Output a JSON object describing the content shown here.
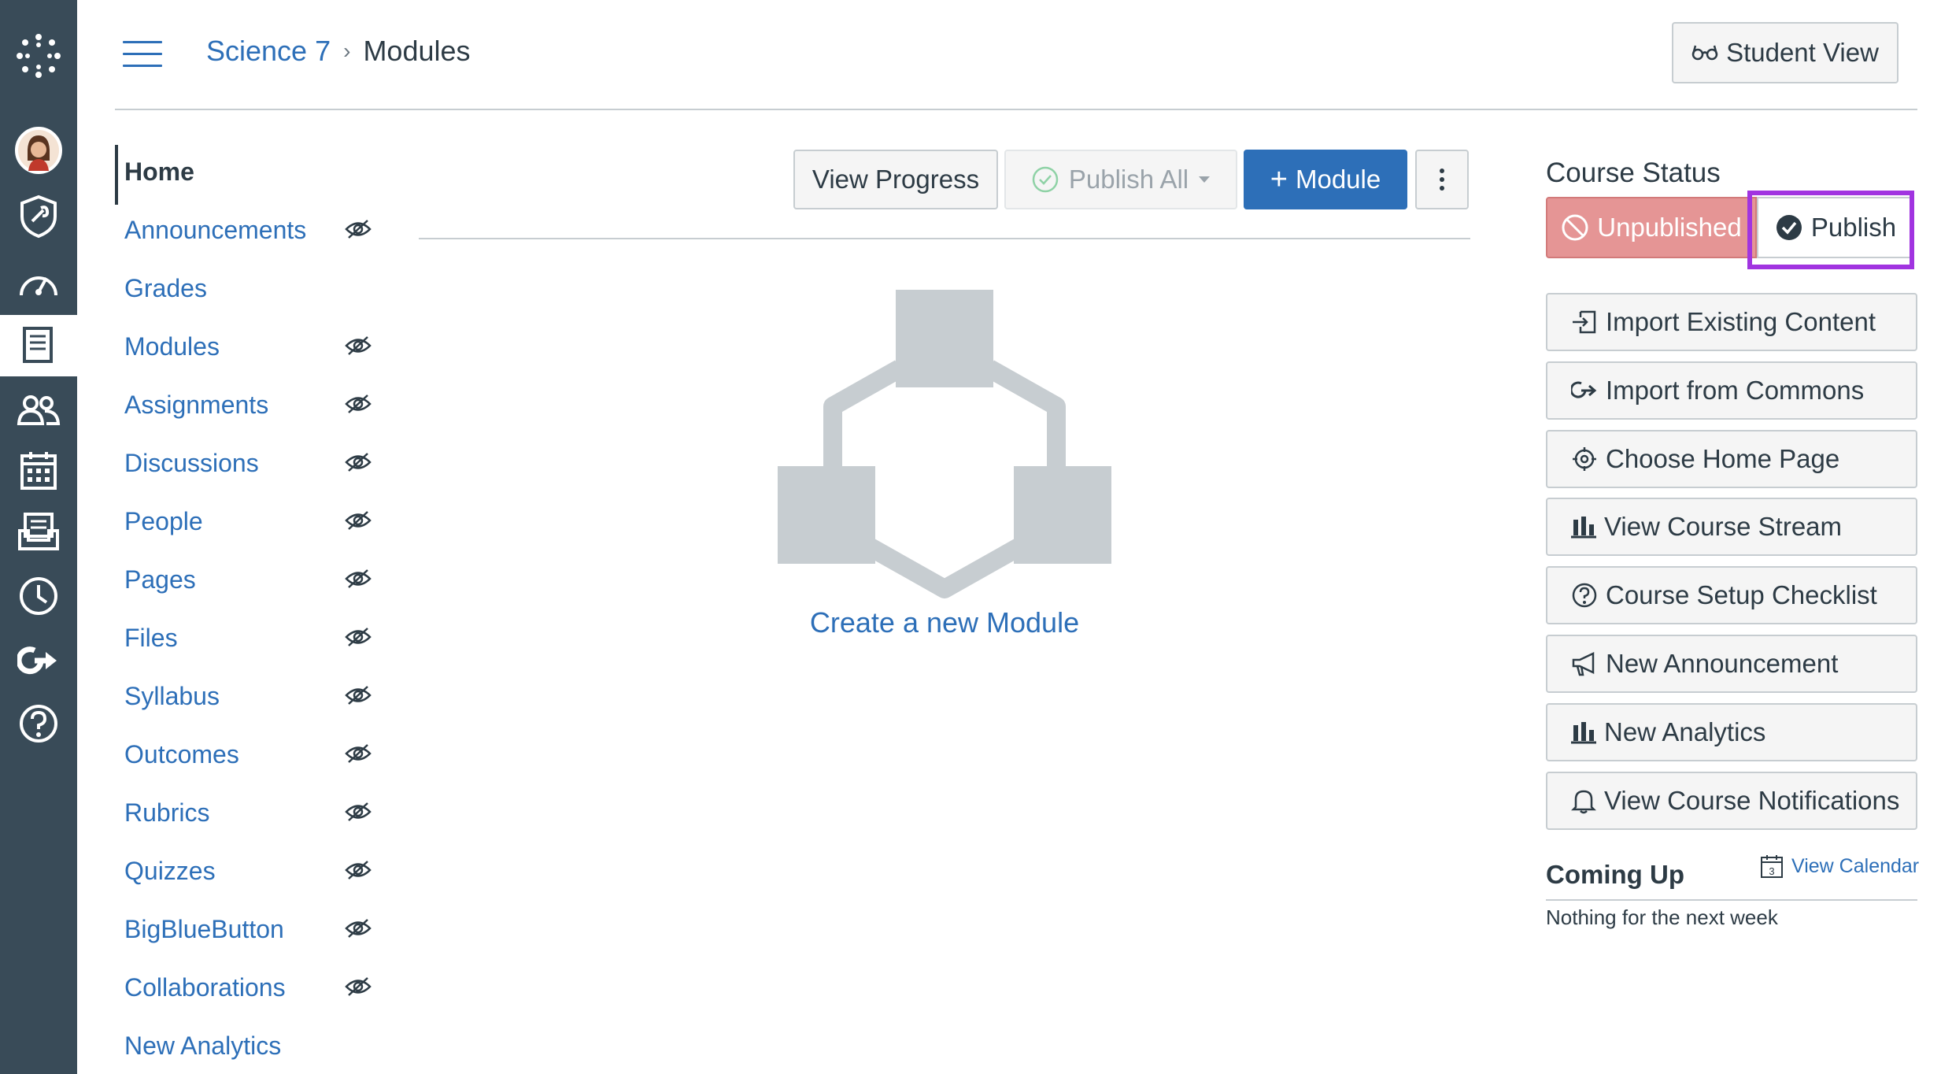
{
  "breadcrumb": {
    "course": "Science 7",
    "separator": "›",
    "page": "Modules"
  },
  "header": {
    "student_view_label": "Student View"
  },
  "global_nav": [
    {
      "name": "logo-icon"
    },
    {
      "name": "account-avatar"
    },
    {
      "name": "admin-icon"
    },
    {
      "name": "dashboard-icon"
    },
    {
      "name": "courses-icon",
      "active": true
    },
    {
      "name": "groups-icon"
    },
    {
      "name": "calendar-icon"
    },
    {
      "name": "inbox-icon"
    },
    {
      "name": "history-icon"
    },
    {
      "name": "commons-icon"
    },
    {
      "name": "help-icon"
    }
  ],
  "course_nav": {
    "items": [
      {
        "label": "Home",
        "active": true,
        "hidden": false
      },
      {
        "label": "Announcements",
        "hidden": true
      },
      {
        "label": "Grades",
        "hidden": false
      },
      {
        "label": "Modules",
        "hidden": true
      },
      {
        "label": "Assignments",
        "hidden": true
      },
      {
        "label": "Discussions",
        "hidden": true
      },
      {
        "label": "People",
        "hidden": true
      },
      {
        "label": "Pages",
        "hidden": true
      },
      {
        "label": "Files",
        "hidden": true
      },
      {
        "label": "Syllabus",
        "hidden": true
      },
      {
        "label": "Outcomes",
        "hidden": true
      },
      {
        "label": "Rubrics",
        "hidden": true
      },
      {
        "label": "Quizzes",
        "hidden": true
      },
      {
        "label": "BigBlueButton",
        "hidden": true
      },
      {
        "label": "Collaborations",
        "hidden": true
      },
      {
        "label": "New Analytics",
        "hidden": false
      }
    ]
  },
  "toolbar": {
    "view_progress": "View Progress",
    "publish_all": "Publish All",
    "module_plus": "+",
    "module": "Module"
  },
  "empty_state": {
    "create_module": "Create a new Module"
  },
  "sidebar": {
    "course_status_title": "Course Status",
    "unpublished": "Unpublished",
    "publish": "Publish",
    "buttons": [
      {
        "label": "Import Existing Content",
        "icon": "import-icon"
      },
      {
        "label": "Import from Commons",
        "icon": "commons-icon"
      },
      {
        "label": "Choose Home Page",
        "icon": "target-icon"
      },
      {
        "label": "View Course Stream",
        "icon": "stream-icon"
      },
      {
        "label": "Course Setup Checklist",
        "icon": "question-icon"
      },
      {
        "label": "New Announcement",
        "icon": "megaphone-icon"
      },
      {
        "label": "New Analytics",
        "icon": "analytics-icon"
      },
      {
        "label": "View Course Notifications",
        "icon": "bell-icon"
      }
    ],
    "coming_up_title": "Coming Up",
    "view_calendar": "View Calendar",
    "calendar_day": "3",
    "nothing": "Nothing for the next week"
  },
  "colors": {
    "nav_bg": "#394b58",
    "link": "#2d6fb8",
    "primary": "#2d6fb8",
    "unpublished": "#e59595",
    "highlight": "#a134e0",
    "placeholder_graphic": "#c7cdd1"
  }
}
